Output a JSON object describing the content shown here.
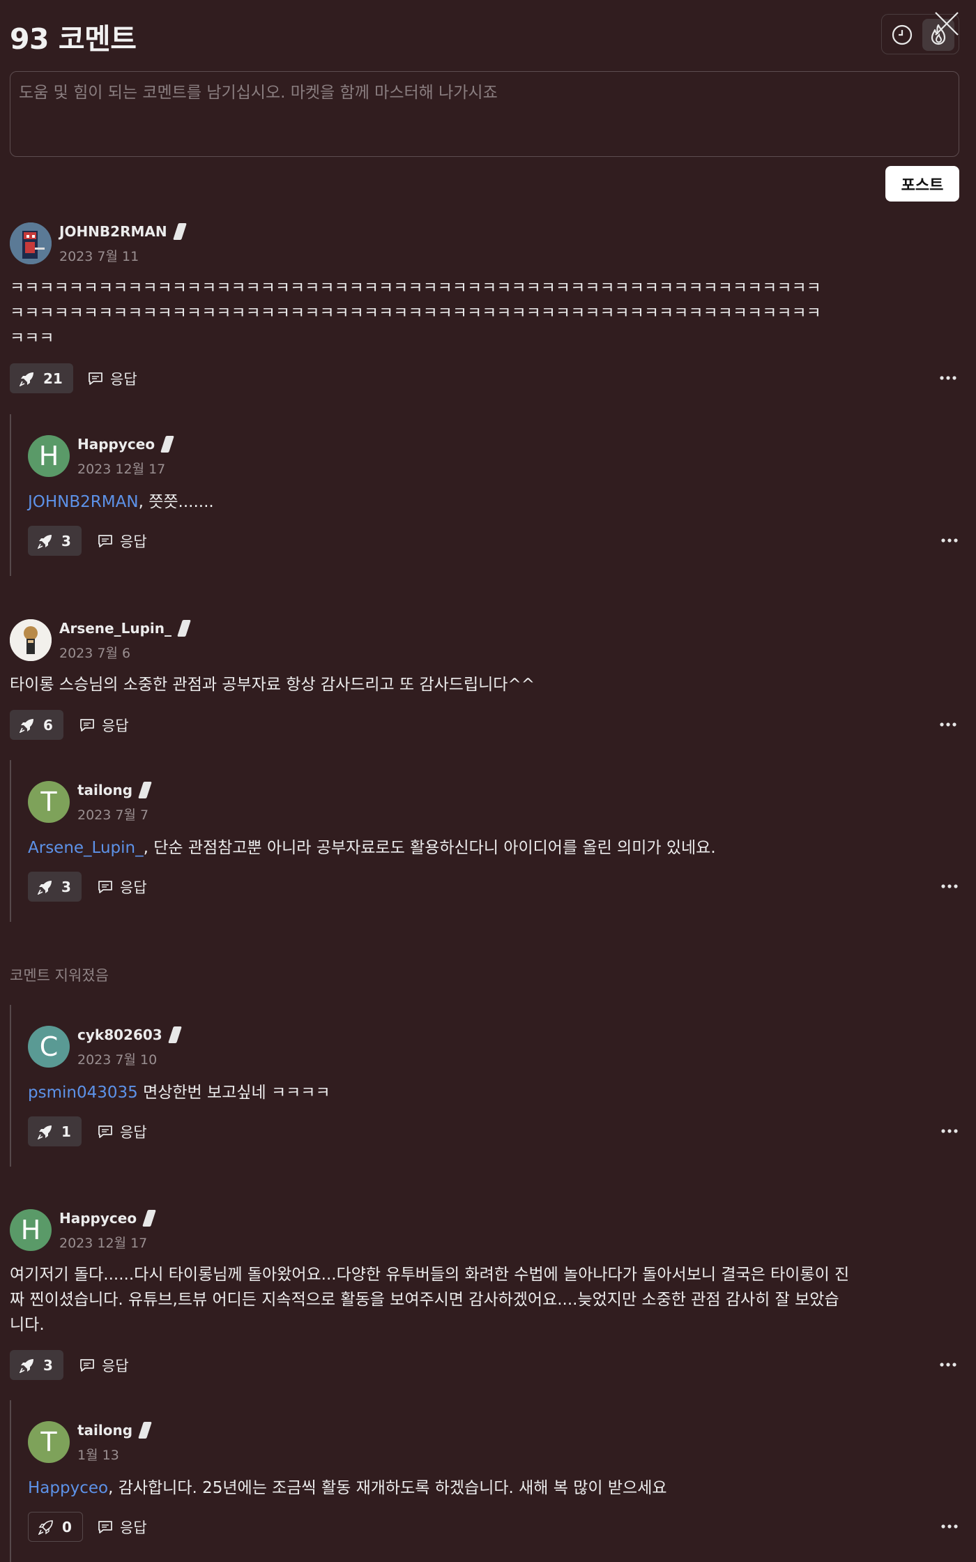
{
  "header": {
    "title": "93 코멘트"
  },
  "composer": {
    "placeholder": "도움 및 힘이 되는 코멘트를 남기십시오. 마켓을 함께 마스터해 나가시죠",
    "post_label": "포스트"
  },
  "reply_label": "응답",
  "comments": [
    {
      "user": "JOHNB2RMAN",
      "date": "2023 7월 11",
      "lines": [
        "ㅋㅋㅋㅋㅋㅋㅋㅋㅋㅋㅋㅋㅋㅋㅋㅋㅋㅋㅋㅋㅋㅋㅋㅋㅋㅋㅋㅋㅋㅋㅋㅋㅋㅋㅋㅋㅋㅋㅋㅋㅋㅋㅋㅋㅋㅋㅋㅋㅋㅋㅋㅋㅋㅋㅋ",
        "ㅋㅋㅋㅋㅋㅋㅋㅋㅋㅋㅋㅋㅋㅋㅋㅋㅋㅋㅋㅋㅋㅋㅋㅋㅋㅋㅋㅋㅋㅋㅋㅋㅋㅋㅋㅋㅋㅋㅋㅋㅋㅋㅋㅋㅋㅋㅋㅋㅋㅋㅋㅋㅋㅋㅋ",
        "ㅋㅋㅋ"
      ],
      "boosts": "21",
      "reply": {
        "user": "Happyceo",
        "avatar": "H",
        "date": "2023 12월 17",
        "mention": "JOHNB2RMAN",
        "text": ",  쯧쯧.......",
        "boosts": "3"
      }
    },
    {
      "user": "Arsene_Lupin_",
      "date": "2023 7월 6",
      "text": "타이롱 스승님의 소중한 관점과 공부자료 항상 감사드리고 또 감사드립니다^^",
      "boosts": "6",
      "reply": {
        "user": "tailong",
        "avatar": "T",
        "date": "2023 7월 7",
        "mention": "Arsene_Lupin_",
        "text": ", 단순 관점참고뿐 아니라 공부자료로도 활용하신다니 아이디어를 올린 의미가 있네요.",
        "boosts": "3"
      }
    },
    {
      "deleted_text": "코멘트 지워졌음",
      "reply": {
        "user": "cyk802603",
        "avatar": "C",
        "date": "2023 7월 10",
        "mention": "psmin043035",
        "text": " 면상한번 보고싶네 ㅋㅋㅋㅋ",
        "boosts": "1"
      }
    },
    {
      "user": "Happyceo",
      "avatar": "H",
      "date": "2023 12월 17",
      "lines": [
        "여기저기 돌다......다시 타이롱님께 돌아왔어요...다양한 유투버들의 화려한 수법에 놀아나다가 돌아서보니 결국은 타이롱이 진",
        "짜 찐이셨습니다. 유튜브,트뷰 어디든 지속적으로 활동을 보여주시면 감사하겠어요....늦었지만 소중한 관점 감사히 잘 보았습",
        "니다."
      ],
      "boosts": "3",
      "reply": {
        "user": "tailong",
        "avatar": "T",
        "date": "1월 13",
        "mention": "Happyceo",
        "text": ", 감사합니다. 25년에는 조금씩 활동 재개하도록 하겠습니다. 새해 복 많이 받으세요",
        "boosts": "0"
      }
    }
  ],
  "colors": {
    "background": "#311d1f",
    "mention": "#5d92e8",
    "avatar_h": "#5a9a68",
    "avatar_t": "#7ea25a",
    "avatar_c": "#5a9a94"
  },
  "icons": {
    "sort_recent": "clock-icon",
    "sort_hot": "fire-icon",
    "close": "close-icon",
    "boost": "rocket-icon",
    "reply": "speech-bubble-icon",
    "more": "more-dots-icon"
  }
}
